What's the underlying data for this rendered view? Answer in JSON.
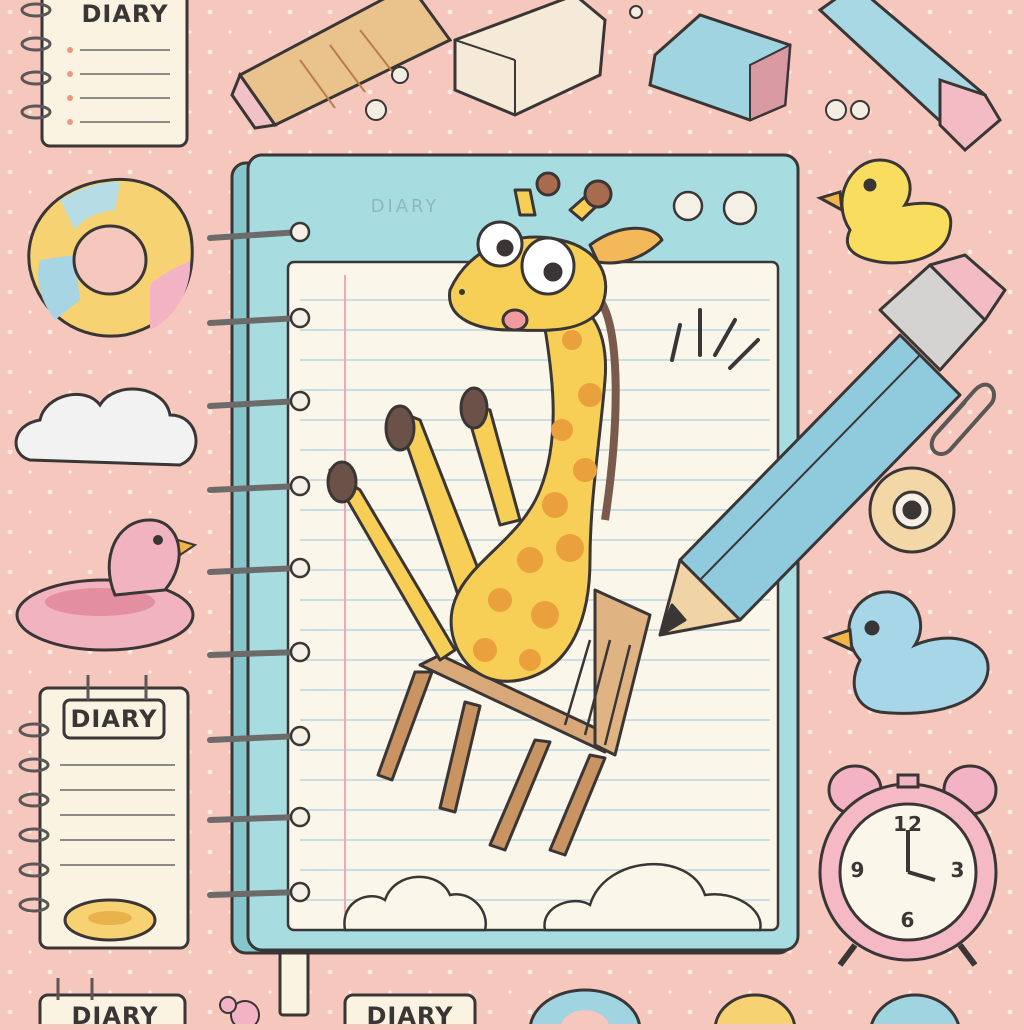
{
  "labels": {
    "diary_top_left": "DIARY",
    "diary_mid_left": "DIARY",
    "diary_bottom_left": "DIARY",
    "diary_bottom_center": "DIARY"
  },
  "notebook": {
    "cover_title": "DIARY"
  },
  "clock": {
    "n12": "12",
    "n3": "3",
    "n6": "6",
    "n9": "9"
  },
  "colors": {
    "background": "#f6c7bd",
    "notebook_cover": "#a7dde0",
    "paper": "#fbf6ea",
    "giraffe": "#f7cf57",
    "giraffe_spots": "#eaa03d",
    "pencil": "#8fcadd",
    "duck_yellow": "#f9dd5f",
    "duck_blue": "#a7d6e8",
    "duck_pink": "#f5b9c6"
  }
}
